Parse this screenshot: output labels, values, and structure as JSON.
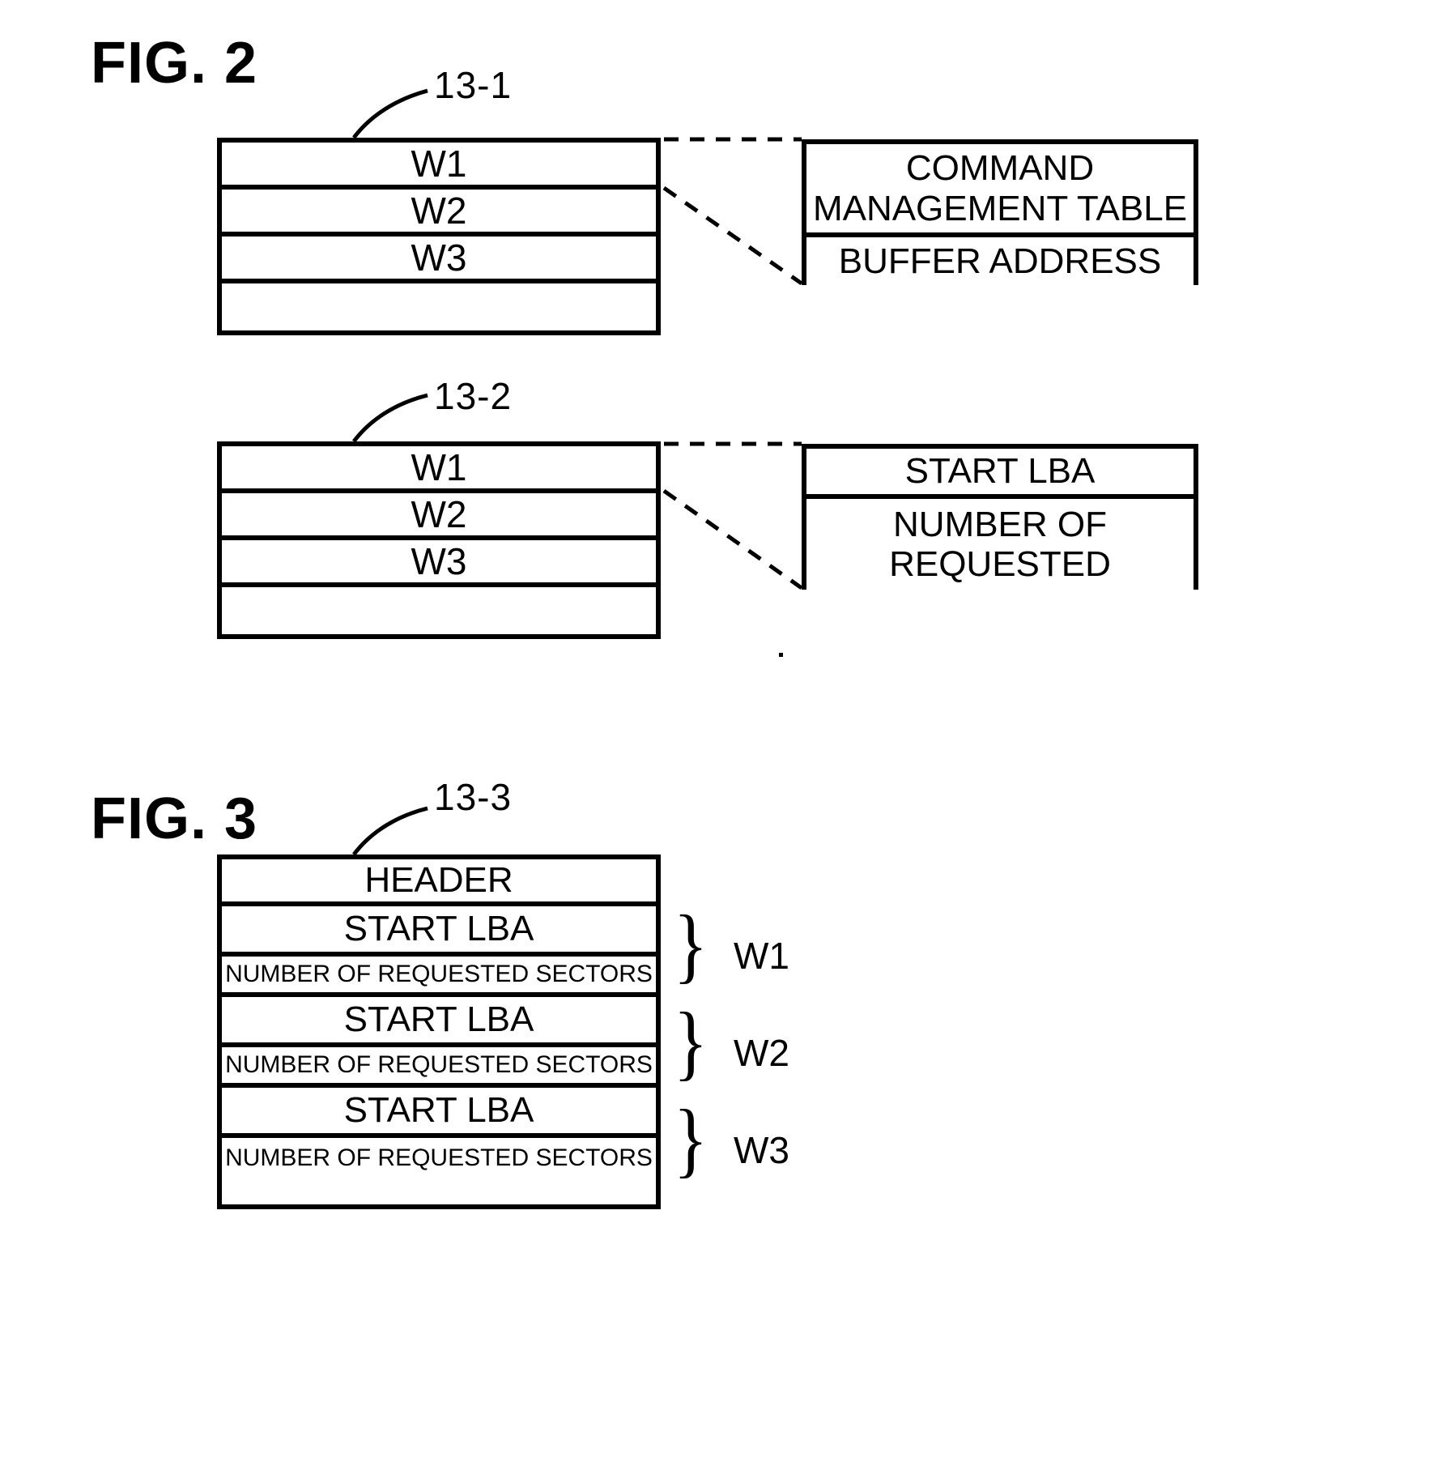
{
  "figures": [
    {
      "id": "fig2",
      "label": "FIG. 2",
      "blocks": [
        {
          "ref": "13-1",
          "rows": [
            "W1",
            "W2",
            "W3",
            ""
          ],
          "detail": {
            "rows": [
              "COMMAND MANAGEMENT TABLE",
              "BUFFER ADDRESS"
            ],
            "row_lines": [
              [
                "COMMAND",
                "MANAGEMENT TABLE"
              ],
              [
                "BUFFER ADDRESS"
              ]
            ]
          }
        },
        {
          "ref": "13-2",
          "rows": [
            "W1",
            "W2",
            "W3",
            ""
          ],
          "detail": {
            "rows": [
              "START LBA",
              "NUMBER OF REQUESTED"
            ],
            "row_lines": [
              [
                "START LBA"
              ],
              [
                "NUMBER OF",
                "REQUESTED"
              ]
            ]
          }
        }
      ]
    },
    {
      "id": "fig3",
      "label": "FIG. 3",
      "ref": "13-3",
      "rows": [
        "HEADER",
        "START LBA",
        "NUMBER OF REQUESTED SECTORS",
        "START LBA",
        "NUMBER OF REQUESTED SECTORS",
        "START LBA",
        "NUMBER OF REQUESTED SECTORS"
      ],
      "groups": [
        {
          "brace": "}",
          "label": "W1"
        },
        {
          "brace": "}",
          "label": "W2"
        },
        {
          "brace": "}",
          "label": "W3"
        }
      ]
    }
  ],
  "colors": {
    "ink": "#000000",
    "paper": "#ffffff"
  }
}
